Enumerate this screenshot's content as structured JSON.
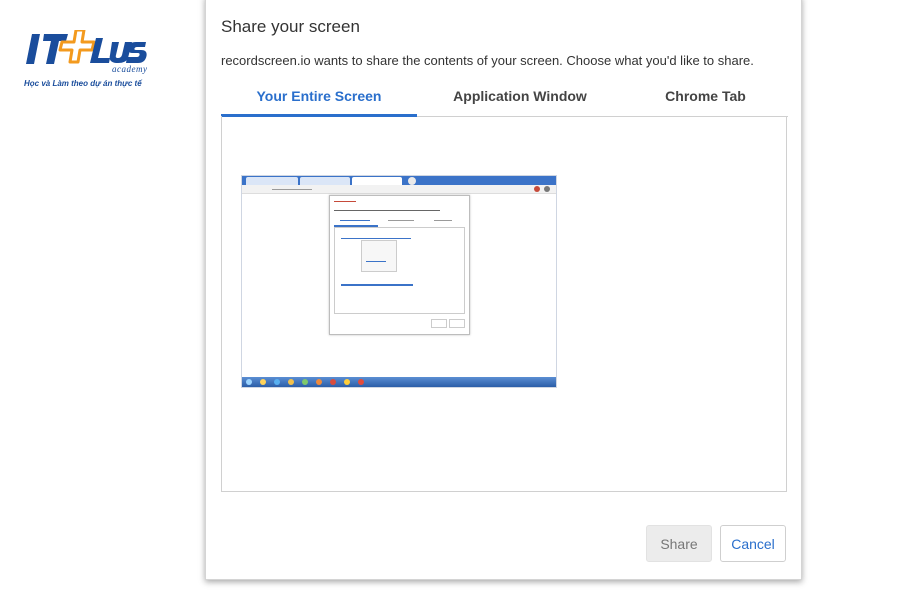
{
  "logo": {
    "brand": "IT PLUS",
    "academy": "academy",
    "tagline": "Học và Làm theo dự án thực tế"
  },
  "dialog": {
    "title": "Share your screen",
    "description": "recordscreen.io wants to share the contents of your screen. Choose what you'd like to share.",
    "tabs": [
      {
        "label": "Your Entire Screen",
        "active": true
      },
      {
        "label": "Application Window",
        "active": false
      },
      {
        "label": "Chrome Tab",
        "active": false
      }
    ],
    "buttons": {
      "share_label": "Share",
      "cancel_label": "Cancel"
    }
  },
  "colors": {
    "accent": "#2a6fcc",
    "logo_blue": "#1a4d9c",
    "logo_orange": "#f39a1e"
  }
}
